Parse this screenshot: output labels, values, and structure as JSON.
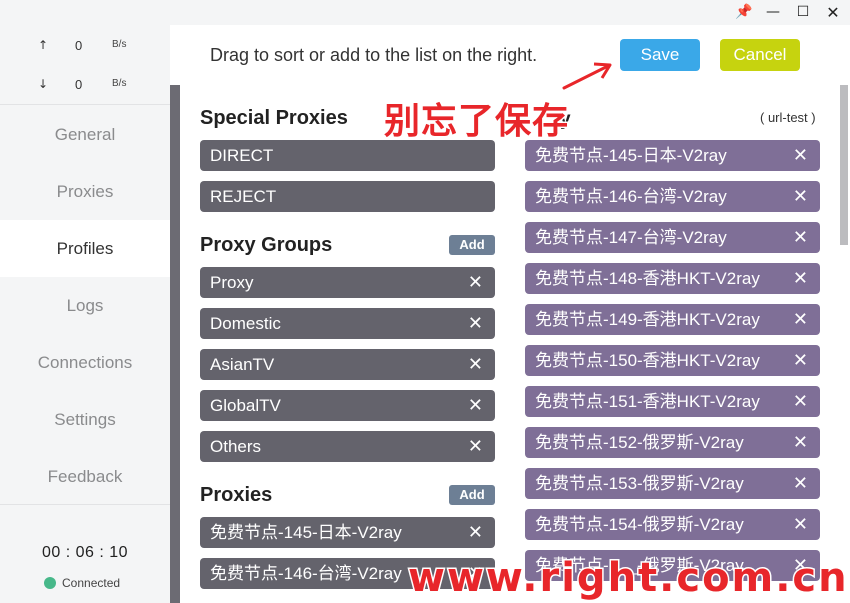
{
  "window": {
    "pin_icon": "pin-icon",
    "min_icon": "minimize-icon",
    "max_icon": "maximize-icon",
    "close_icon": "close-icon"
  },
  "sidebar": {
    "upload": {
      "arrow": "↑",
      "value": "0",
      "unit": "B/s"
    },
    "download": {
      "arrow": "↓",
      "value": "0",
      "unit": "B/s"
    },
    "items": [
      {
        "label": "General"
      },
      {
        "label": "Proxies"
      },
      {
        "label": "Profiles",
        "active": true
      },
      {
        "label": "Logs"
      },
      {
        "label": "Connections"
      },
      {
        "label": "Settings"
      },
      {
        "label": "Feedback"
      }
    ],
    "timer": "00 : 06 : 10",
    "status": "Connected",
    "status_color": "#47b88a"
  },
  "header": {
    "hint": "Drag to sort or add to the list on the right.",
    "save_label": "Save",
    "cancel_label": "Cancel"
  },
  "special_proxies": {
    "title": "Special Proxies",
    "items": [
      "DIRECT",
      "REJECT"
    ]
  },
  "proxy_groups": {
    "title": "Proxy Groups",
    "add_label": "Add",
    "items": [
      "Proxy",
      "Domestic",
      "AsianTV",
      "GlobalTV",
      "Others"
    ]
  },
  "proxies": {
    "title": "Proxies",
    "add_label": "Add",
    "items": [
      "免费节点-145-日本-V2ray",
      "免费节点-146-台湾-V2ray"
    ]
  },
  "group_editor": {
    "title_visible_fragment": "y",
    "type": "( url-test )",
    "items": [
      "免费节点-145-日本-V2ray",
      "免费节点-146-台湾-V2ray",
      "免费节点-147-台湾-V2ray",
      "免费节点-148-香港HKT-V2ray",
      "免费节点-149-香港HKT-V2ray",
      "免费节点-150-香港HKT-V2ray",
      "免费节点-151-香港HKT-V2ray",
      "免费节点-152-俄罗斯-V2ray",
      "免费节点-153-俄罗斯-V2ray",
      "免费节点-154-俄罗斯-V2ray",
      "免费节点-1__-俄罗斯-V2ray"
    ]
  },
  "annotation": {
    "text": "别忘了保存",
    "watermark": "www.right.com.cn",
    "color": "#e8262a"
  },
  "colors": {
    "save": "#3aa8e8",
    "cancel": "#c6d30f",
    "chip_left": "#64636c",
    "chip_right": "#7f6f97",
    "add": "#6d7f95"
  },
  "remove_glyph": "✕"
}
